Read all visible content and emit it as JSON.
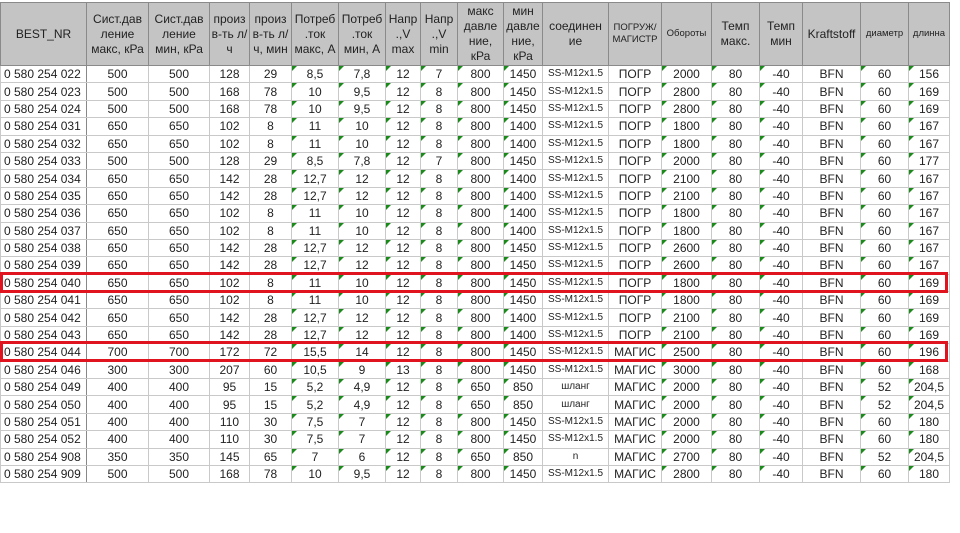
{
  "columns": [
    "BEST_NR",
    "Сист.дав ление макс, кРа",
    "Сист.дав ление мин, кРа",
    "произ в-ть л/ч",
    "произ в-ть л/ч, мин",
    "Потреб .ток макс, А",
    "Потреб .ток мин, А",
    "Напр .,V max",
    "Напр .,V min",
    "макс давле ние, кРа",
    "мин давле ние, кРа",
    "соединен ие",
    "ПОГРУЖ/ МАГИСТР",
    "Обороты",
    "Темп макс.",
    "Темп мин",
    "Kraftstoff",
    "диаметр",
    "длинна"
  ],
  "rows": [
    [
      "0 580 254 022",
      "500",
      "500",
      "128",
      "29",
      "8,5",
      "7,8",
      "12",
      "7",
      "800",
      "1450",
      "SS-M12x1.5",
      "ПОГР",
      "2000",
      "80",
      "-40",
      "BFN",
      "60",
      "156"
    ],
    [
      "0 580 254 023",
      "500",
      "500",
      "168",
      "78",
      "10",
      "9,5",
      "12",
      "8",
      "800",
      "1450",
      "SS-M12x1.5",
      "ПОГР",
      "2800",
      "80",
      "-40",
      "BFN",
      "60",
      "169"
    ],
    [
      "0 580 254 024",
      "500",
      "500",
      "168",
      "78",
      "10",
      "9,5",
      "12",
      "8",
      "800",
      "1450",
      "SS-M12x1.5",
      "ПОГР",
      "2800",
      "80",
      "-40",
      "BFN",
      "60",
      "169"
    ],
    [
      "0 580 254 031",
      "650",
      "650",
      "102",
      "8",
      "11",
      "10",
      "12",
      "8",
      "800",
      "1400",
      "SS-M12x1.5",
      "ПОГР",
      "1800",
      "80",
      "-40",
      "BFN",
      "60",
      "167"
    ],
    [
      "0 580 254 032",
      "650",
      "650",
      "102",
      "8",
      "11",
      "10",
      "12",
      "8",
      "800",
      "1400",
      "SS-M12x1.5",
      "ПОГР",
      "1800",
      "80",
      "-40",
      "BFN",
      "60",
      "167"
    ],
    [
      "0 580 254 033",
      "500",
      "500",
      "128",
      "29",
      "8,5",
      "7,8",
      "12",
      "7",
      "800",
      "1450",
      "SS-M12x1.5",
      "ПОГР",
      "2000",
      "80",
      "-40",
      "BFN",
      "60",
      "177"
    ],
    [
      "0 580 254 034",
      "650",
      "650",
      "142",
      "28",
      "12,7",
      "12",
      "12",
      "8",
      "800",
      "1400",
      "SS-M12x1.5",
      "ПОГР",
      "2100",
      "80",
      "-40",
      "BFN",
      "60",
      "167"
    ],
    [
      "0 580 254 035",
      "650",
      "650",
      "142",
      "28",
      "12,7",
      "12",
      "12",
      "8",
      "800",
      "1400",
      "SS-M12x1.5",
      "ПОГР",
      "2100",
      "80",
      "-40",
      "BFN",
      "60",
      "167"
    ],
    [
      "0 580 254 036",
      "650",
      "650",
      "102",
      "8",
      "11",
      "10",
      "12",
      "8",
      "800",
      "1400",
      "SS-M12x1.5",
      "ПОГР",
      "1800",
      "80",
      "-40",
      "BFN",
      "60",
      "167"
    ],
    [
      "0 580 254 037",
      "650",
      "650",
      "102",
      "8",
      "11",
      "10",
      "12",
      "8",
      "800",
      "1400",
      "SS-M12x1.5",
      "ПОГР",
      "1800",
      "80",
      "-40",
      "BFN",
      "60",
      "167"
    ],
    [
      "0 580 254 038",
      "650",
      "650",
      "142",
      "28",
      "12,7",
      "12",
      "12",
      "8",
      "800",
      "1450",
      "SS-M12x1.5",
      "ПОГР",
      "2600",
      "80",
      "-40",
      "BFN",
      "60",
      "167"
    ],
    [
      "0 580 254 039",
      "650",
      "650",
      "142",
      "28",
      "12,7",
      "12",
      "12",
      "8",
      "800",
      "1450",
      "SS-M12x1.5",
      "ПОГР",
      "2600",
      "80",
      "-40",
      "BFN",
      "60",
      "167"
    ],
    [
      "0 580 254 040",
      "650",
      "650",
      "102",
      "8",
      "11",
      "10",
      "12",
      "8",
      "800",
      "1450",
      "SS-M12x1.5",
      "ПОГР",
      "1800",
      "80",
      "-40",
      "BFN",
      "60",
      "169"
    ],
    [
      "0 580 254 041",
      "650",
      "650",
      "102",
      "8",
      "11",
      "10",
      "12",
      "8",
      "800",
      "1450",
      "SS-M12x1.5",
      "ПОГР",
      "1800",
      "80",
      "-40",
      "BFN",
      "60",
      "169"
    ],
    [
      "0 580 254 042",
      "650",
      "650",
      "142",
      "28",
      "12,7",
      "12",
      "12",
      "8",
      "800",
      "1400",
      "SS-M12x1.5",
      "ПОГР",
      "2100",
      "80",
      "-40",
      "BFN",
      "60",
      "169"
    ],
    [
      "0 580 254 043",
      "650",
      "650",
      "142",
      "28",
      "12,7",
      "12",
      "12",
      "8",
      "800",
      "1400",
      "SS-M12x1.5",
      "ПОГР",
      "2100",
      "80",
      "-40",
      "BFN",
      "60",
      "169"
    ],
    [
      "0 580 254 044",
      "700",
      "700",
      "172",
      "72",
      "15,5",
      "14",
      "12",
      "8",
      "800",
      "1450",
      "SS-M12x1.5",
      "МАГИС",
      "2500",
      "80",
      "-40",
      "BFN",
      "60",
      "196"
    ],
    [
      "0 580 254 046",
      "300",
      "300",
      "207",
      "60",
      "10,5",
      "9",
      "13",
      "8",
      "800",
      "1450",
      "SS-M12x1.5",
      "МАГИС",
      "3000",
      "80",
      "-40",
      "BFN",
      "60",
      "168"
    ],
    [
      "0 580 254 049",
      "400",
      "400",
      "95",
      "15",
      "5,2",
      "4,9",
      "12",
      "8",
      "650",
      "850",
      "шланг",
      "МАГИС",
      "2000",
      "80",
      "-40",
      "BFN",
      "52",
      "204,5"
    ],
    [
      "0 580 254 050",
      "400",
      "400",
      "95",
      "15",
      "5,2",
      "4,9",
      "12",
      "8",
      "650",
      "850",
      "шланг",
      "МАГИС",
      "2000",
      "80",
      "-40",
      "BFN",
      "52",
      "204,5"
    ],
    [
      "0 580 254 051",
      "400",
      "400",
      "110",
      "30",
      "7,5",
      "7",
      "12",
      "8",
      "800",
      "1450",
      "SS-M12x1.5",
      "МАГИС",
      "2000",
      "80",
      "-40",
      "BFN",
      "60",
      "180"
    ],
    [
      "0 580 254 052",
      "400",
      "400",
      "110",
      "30",
      "7,5",
      "7",
      "12",
      "8",
      "800",
      "1450",
      "SS-M12x1.5",
      "МАГИС",
      "2000",
      "80",
      "-40",
      "BFN",
      "60",
      "180"
    ],
    [
      "0 580 254 908",
      "350",
      "350",
      "145",
      "65",
      "7",
      "6",
      "12",
      "8",
      "650",
      "850",
      "n",
      "МАГИС",
      "2700",
      "80",
      "-40",
      "BFN",
      "52",
      "204,5"
    ],
    [
      "0 580 254 909",
      "500",
      "500",
      "168",
      "78",
      "10",
      "9,5",
      "12",
      "8",
      "800",
      "1450",
      "SS-M12x1.5",
      "МАГИС",
      "2800",
      "80",
      "-40",
      "BFN",
      "60",
      "180"
    ]
  ],
  "highlighted_rows": [
    "0 580 254 040",
    "0 580 254 044"
  ],
  "colors": {
    "highlight": "#e0141e",
    "header_bg": "#c4c4c4",
    "text_indicator": "#1a8a1a"
  }
}
